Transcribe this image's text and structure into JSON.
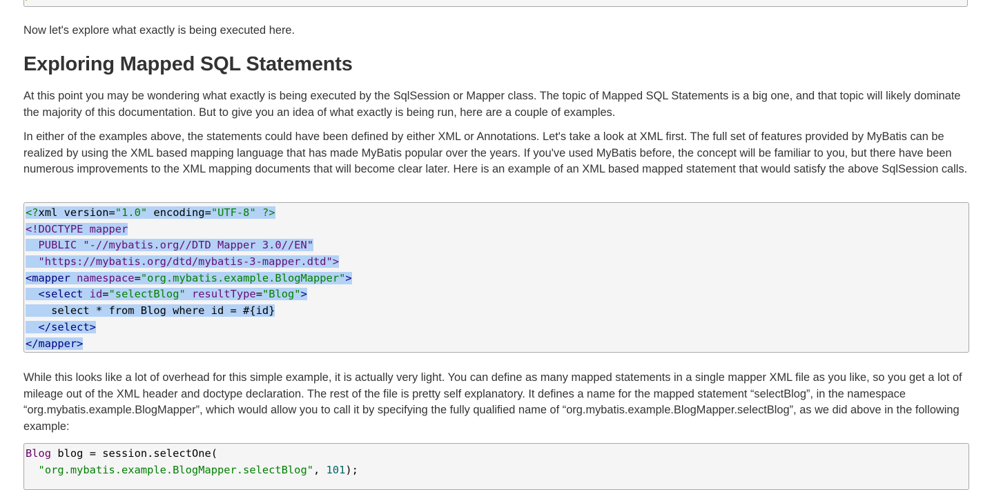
{
  "intro": "Now let's explore what exactly is being executed here.",
  "heading": "Exploring Mapped SQL Statements",
  "para1": "At this point you may be wondering what exactly is being executed by the SqlSession or Mapper class. The topic of Mapped SQL Statements is a big one, and that topic will likely dominate the majority of this documentation. But to give you an idea of what exactly is being run, here are a couple of examples.",
  "para2": "In either of the examples above, the statements could have been defined by either XML or Annotations. Let's take a look at XML first. The full set of features provided by MyBatis can be realized by using the XML based mapping language that has made MyBatis popular over the years. If you've used MyBatis before, the concept will be familiar to you, but there have been numerous improvements to the XML mapping documents that will become clear later. Here is an example of an XML based mapped statement that would satisfy the above SqlSession calls.",
  "xml_code": {
    "l1": {
      "open": "<?",
      "name": "xml",
      "a1": "version",
      "eq1": "=",
      "v1": "\"1.0\"",
      "a2": "encoding",
      "eq2": "=",
      "v2": "\"UTF-8\"",
      "close": "?>"
    },
    "l2": "<!DOCTYPE mapper",
    "l3": "  PUBLIC \"-//mybatis.org//DTD Mapper 3.0//EN\"",
    "l4": "  \"https://mybatis.org/dtd/mybatis-3-mapper.dtd\">",
    "l5": {
      "open": "<mapper",
      "a1": "namespace",
      "eq1": "=",
      "v1": "\"org.mybatis.example.BlogMapper\"",
      "close": ">"
    },
    "l6": {
      "indent": "  ",
      "open": "<select",
      "a1": "id",
      "eq1": "=",
      "v1": "\"selectBlog\"",
      "a2": "resultType",
      "eq2": "=",
      "v2": "\"Blog\"",
      "close": ">"
    },
    "l7": "    select * from Blog where id = #{id}",
    "l8": {
      "indent": "  ",
      "tag": "</select>"
    },
    "l9": "</mapper>"
  },
  "para3": "While this looks like a lot of overhead for this simple example, it is actually very light. You can define as many mapped statements in a single mapper XML file as you like, so you get a lot of mileage out of the XML header and doctype declaration. The rest of the file is pretty self explanatory. It defines a name for the mapped statement “selectBlog”, in the namespace “org.mybatis.example.BlogMapper”, which would allow you to call it by specifying the fully qualified name of “org.mybatis.example.BlogMapper.selectBlog”, as we did above in the following example:",
  "java_code": {
    "type": "Blog",
    "var": " blog ",
    "eq": "=",
    "call": " session.selectOne",
    "paren": "(",
    "indent": "  ",
    "arg": "\"org.mybatis.example.BlogMapper.selectBlog\"",
    "comma": ", ",
    "num": "101",
    "end": ");"
  }
}
